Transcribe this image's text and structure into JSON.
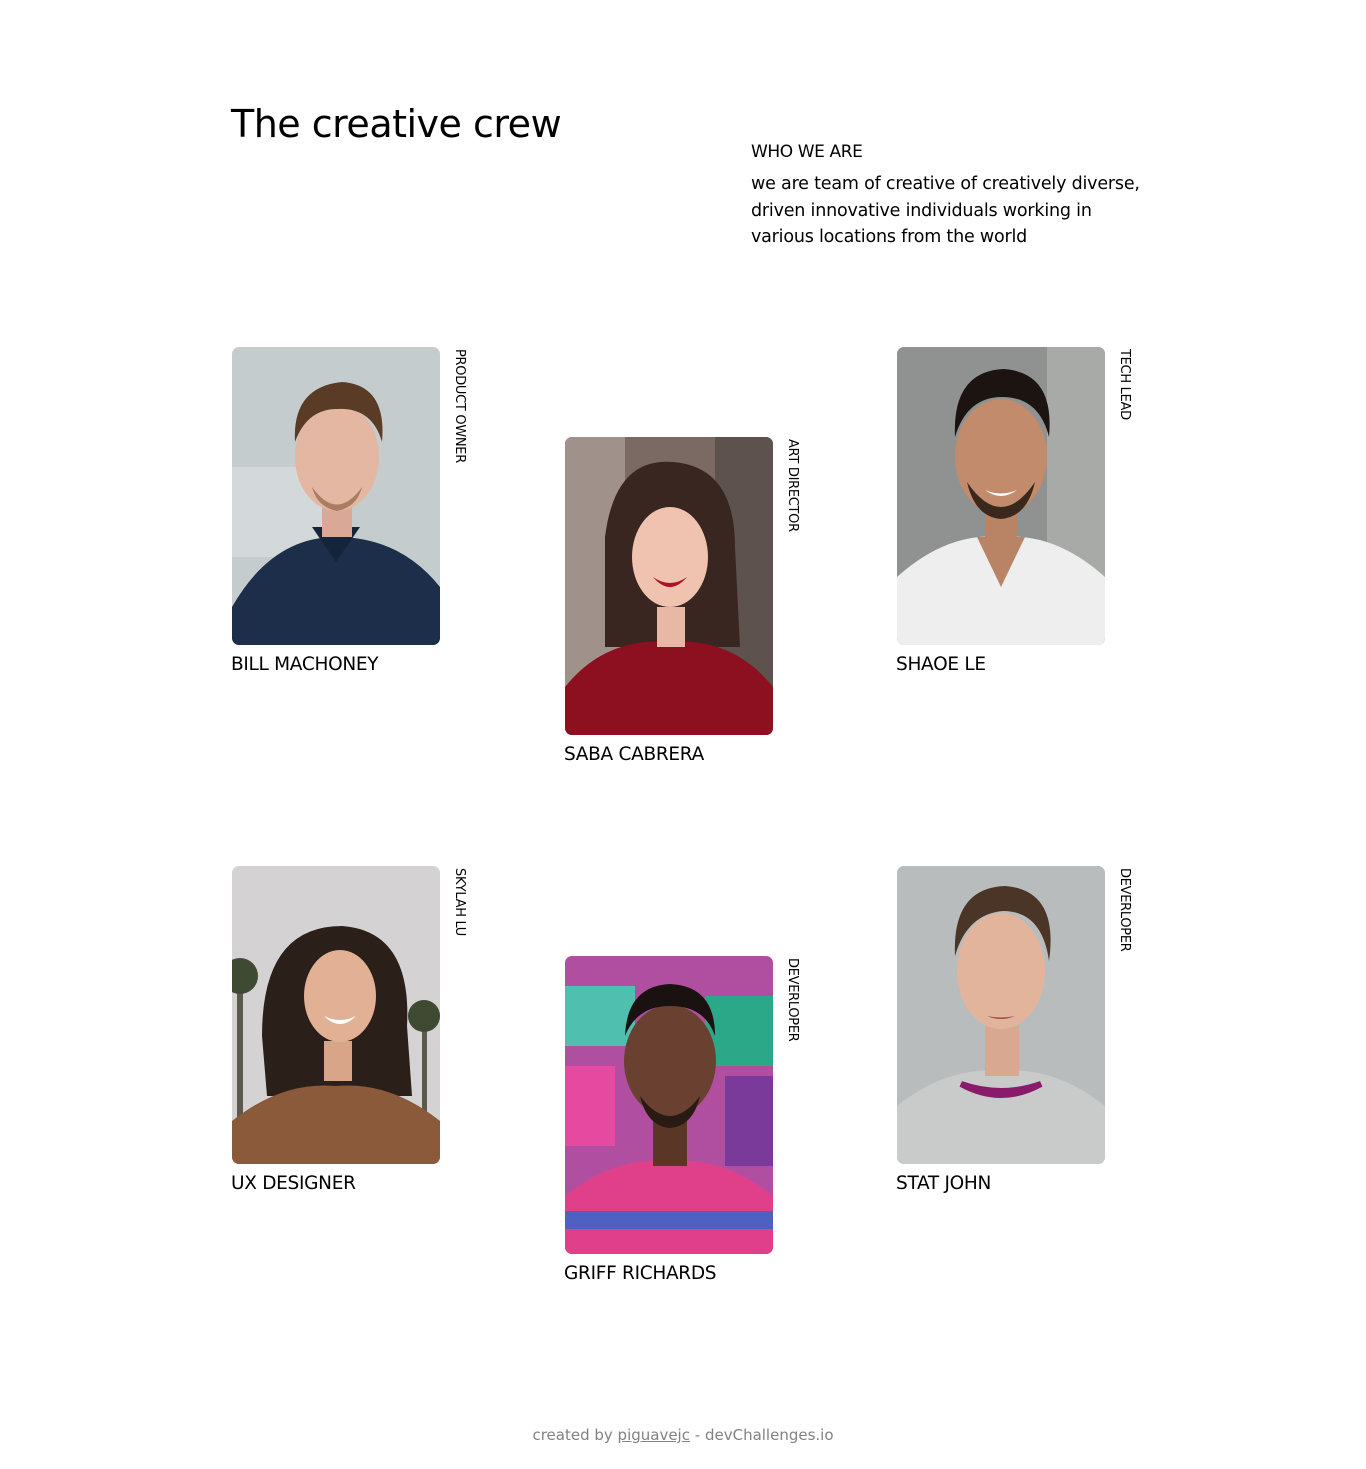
{
  "header": {
    "title": "The creative crew",
    "who_label": "WHO WE ARE",
    "who_text": "we are team of creative of creatively diverse, driven innovative individuals working in various locations from the world"
  },
  "team": [
    {
      "name": "BILL MACHONEY",
      "role": "PRODUCT OWNER"
    },
    {
      "name": "SABA CABRERA",
      "role": "ART DIRECTOR"
    },
    {
      "name": "SHAOE LE",
      "role": "TECH LEAD"
    },
    {
      "name": "UX DESIGNER",
      "role": "SKYLAH LU"
    },
    {
      "name": "GRIFF RICHARDS",
      "role": "DEVERLOPER"
    },
    {
      "name": "STAT JOHN",
      "role": "DEVERLOPER"
    }
  ],
  "footer": {
    "prefix": "created by",
    "author": "piguavejc",
    "separator": "-",
    "site": "devChallenges.io"
  },
  "colors": {
    "text": "#000000",
    "footer_text": "#828282",
    "background": "#ffffff"
  }
}
